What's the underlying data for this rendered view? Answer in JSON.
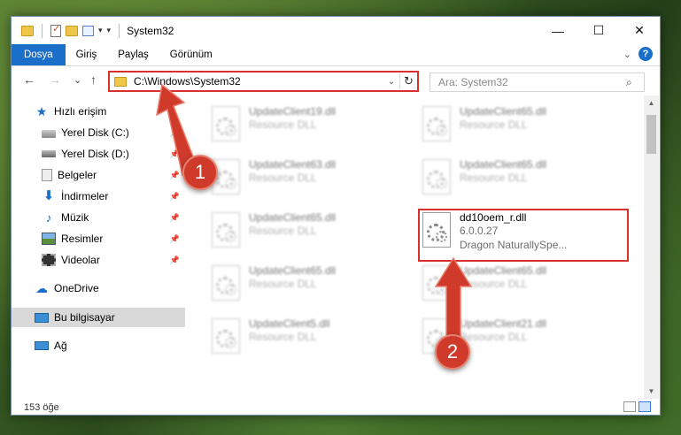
{
  "window": {
    "title": "System32",
    "controls": {
      "minimize": "—",
      "maximize": "☐",
      "close": "✕"
    }
  },
  "ribbon": {
    "tabs": [
      "Dosya",
      "Giriş",
      "Paylaş",
      "Görünüm"
    ],
    "active_tab": "Dosya",
    "collapse_icon": "chevron-down-icon",
    "help": "?"
  },
  "navigation": {
    "back": "←",
    "forward": "→",
    "recent": "⌄",
    "up": "↑",
    "address": "C:\\Windows\\System32",
    "address_dropdown": "⌄",
    "refresh": "↻",
    "search_placeholder": "Ara: System32",
    "search_icon": "⌕"
  },
  "sidebar": {
    "items": [
      {
        "label": "Hızlı erişim",
        "icon": "star-icon"
      },
      {
        "label": "Yerel Disk (C:)",
        "icon": "disk-icon",
        "pinned": true
      },
      {
        "label": "Yerel Disk (D:)",
        "icon": "disk-icon",
        "pinned": true
      },
      {
        "label": "Belgeler",
        "icon": "document-icon",
        "pinned": true
      },
      {
        "label": "İndirmeler",
        "icon": "download-icon",
        "pinned": true
      },
      {
        "label": "Müzik",
        "icon": "music-icon",
        "pinned": true
      },
      {
        "label": "Resimler",
        "icon": "pictures-icon",
        "pinned": true
      },
      {
        "label": "Videolar",
        "icon": "video-icon",
        "pinned": true
      },
      {
        "label": "OneDrive",
        "icon": "cloud-icon"
      },
      {
        "label": "Bu bilgisayar",
        "icon": "computer-icon",
        "selected": true
      },
      {
        "label": "Ağ",
        "icon": "network-icon"
      }
    ],
    "pin_glyph": "📌"
  },
  "files": {
    "column_left": [
      {
        "name": "UpdateClient19.dll",
        "type": "Resource DLL"
      },
      {
        "name": "UpdateClient63.dll",
        "type": "Resource DLL"
      },
      {
        "name": "UpdateClient65.dll",
        "type": "Resource DLL"
      },
      {
        "name": "UpdateClient65.dll",
        "type": "Resource DLL"
      },
      {
        "name": "UpdateClient5.dll",
        "type": "Resource DLL"
      }
    ],
    "column_right": [
      {
        "name": "UpdateClient65.dll",
        "type": "Resource DLL"
      },
      {
        "name": "UpdateClient65.dll",
        "type": "Resource DLL"
      },
      {
        "name": "UpdateClient65.dll",
        "type": "Resource DLL"
      },
      {
        "name": "UpdateClient21.dll",
        "type": "Resource DLL"
      }
    ],
    "highlighted": {
      "name": "dd10oem_r.dll",
      "version": "6.0.0.27",
      "company": "Dragon NaturallySpe..."
    }
  },
  "status": {
    "item_count": "153 öğe"
  },
  "callouts": {
    "one": "1",
    "two": "2",
    "color": "#cf3a2b"
  },
  "colors": {
    "accent": "#1a6fc9",
    "highlight_border": "#d9302c"
  }
}
